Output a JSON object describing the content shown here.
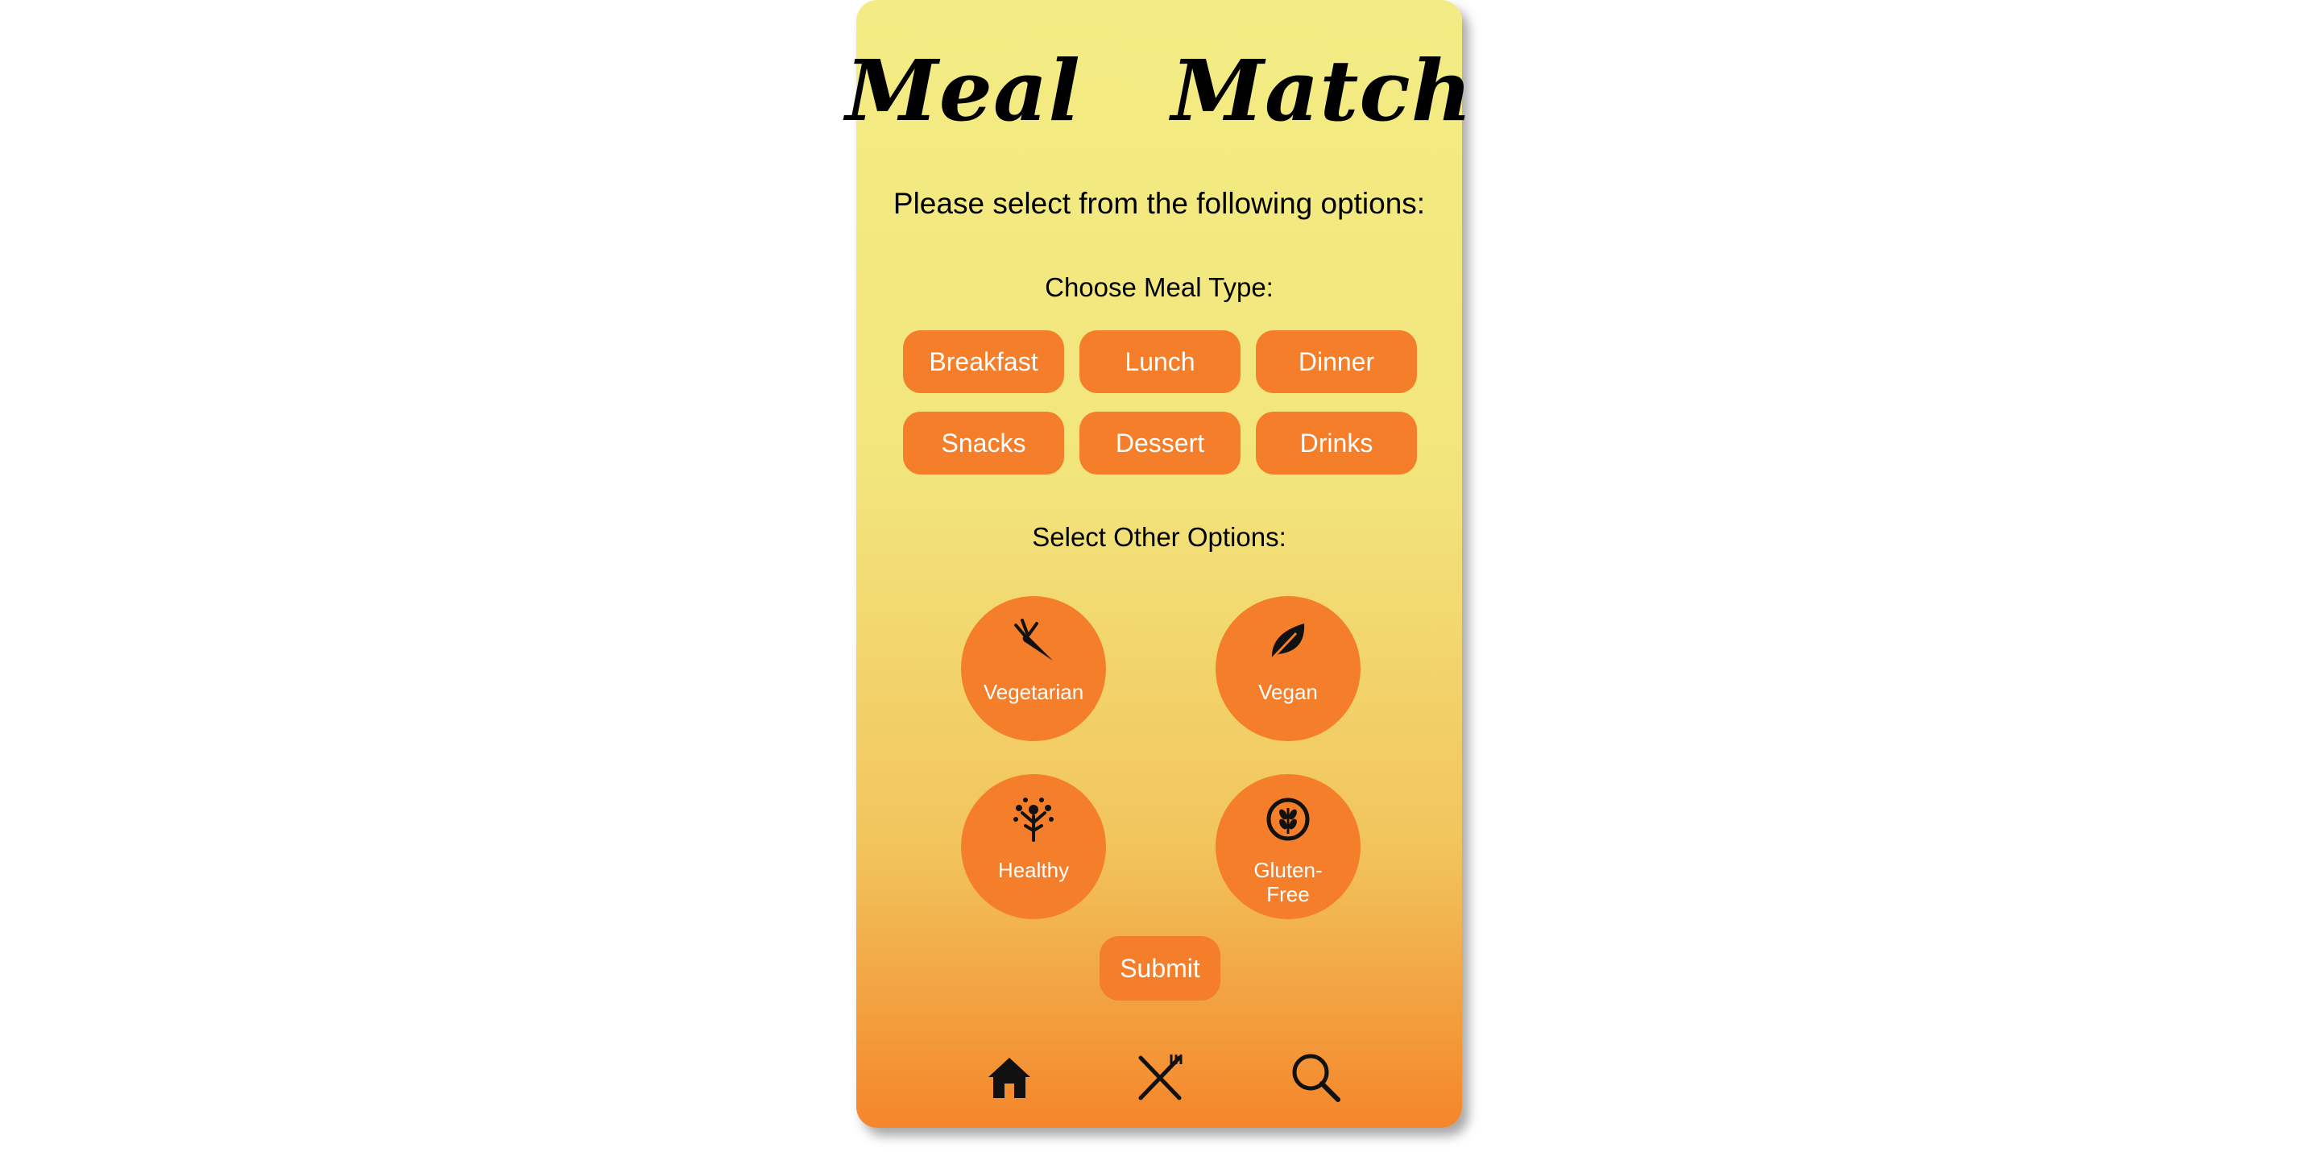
{
  "app": {
    "title_left": "Meal",
    "title_right": "Match",
    "title_icon": "plate-fork-knife-icon",
    "prompt": "Please select from the following options:"
  },
  "meal_type": {
    "label": "Choose Meal Type:",
    "options": [
      "Breakfast",
      "Lunch",
      "Dinner",
      "Snacks",
      "Dessert",
      "Drinks"
    ]
  },
  "other_options": {
    "label": "Select Other Options:",
    "items": [
      {
        "label": "Vegetarian",
        "icon": "carrot-icon"
      },
      {
        "label": "Vegan",
        "icon": "leaf-icon"
      },
      {
        "label": "Healthy",
        "icon": "healthy-tree-person-icon"
      },
      {
        "label_line1": "Gluten-",
        "label_line2": "Free",
        "icon": "wheat-circle-icon"
      }
    ]
  },
  "submit_label": "Submit",
  "nav": {
    "items": [
      {
        "icon": "home-icon"
      },
      {
        "icon": "fork-knife-cross-icon"
      },
      {
        "icon": "search-icon"
      }
    ]
  },
  "colors": {
    "accent": "#f47e2a",
    "gradient_top": "#f3ec84",
    "gradient_bottom": "#f5852a"
  }
}
